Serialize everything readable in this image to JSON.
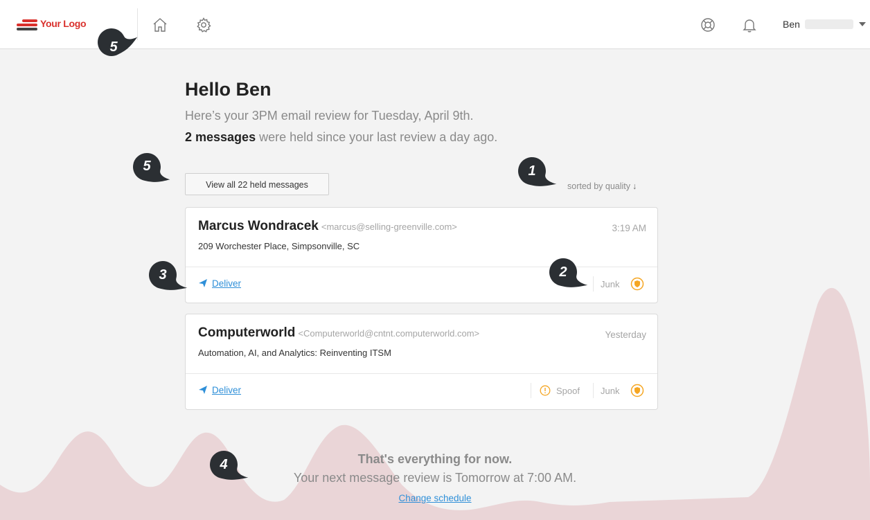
{
  "app": {
    "logo_text": "Your Logo"
  },
  "nav": {
    "icons": [
      "home-icon",
      "gear-icon"
    ]
  },
  "header_right": {
    "icons": [
      "help-icon",
      "bell-icon"
    ],
    "user_name": "Ben"
  },
  "main": {
    "greeting": "Hello Ben",
    "subline": "Here’s your 3PM email review for Tuesday, April 9th.",
    "summary_bold": "2 messages",
    "summary_rest": " were held since your last review a day ago.",
    "view_all_label": "View all 22 held messages",
    "sort_label": "sorted by quality",
    "sort_arrow": "↓"
  },
  "messages": [
    {
      "sender": "Marcus Wondracek",
      "email": "<marcus@selling-greenville.com>",
      "time": "3:19 AM",
      "subject": "209 Worchester Place, Simpsonville, SC",
      "action": "Deliver",
      "tags": [
        "Junk"
      ]
    },
    {
      "sender": "Computerworld",
      "email": "<Computerworld@cntnt.computerworld.com>",
      "time": "Yesterday",
      "subject": "Automation, AI, and Analytics: Reinventing ITSM",
      "action": "Deliver",
      "tags": [
        "Spoof",
        "Junk"
      ]
    }
  ],
  "footer": {
    "line1": "That's everything for now.",
    "line2": "Your next message review is Tomorrow at 7:00 AM.",
    "change_label": "Change schedule"
  },
  "callouts": [
    "5",
    "5",
    "1",
    "3",
    "2",
    "4"
  ],
  "colors": {
    "accent_blue": "#2e8fd8",
    "logo_red": "#d9302c",
    "wave_pink": "#ead5d7",
    "shield_orange": "#f5a623",
    "marker": "#2b2f33"
  }
}
